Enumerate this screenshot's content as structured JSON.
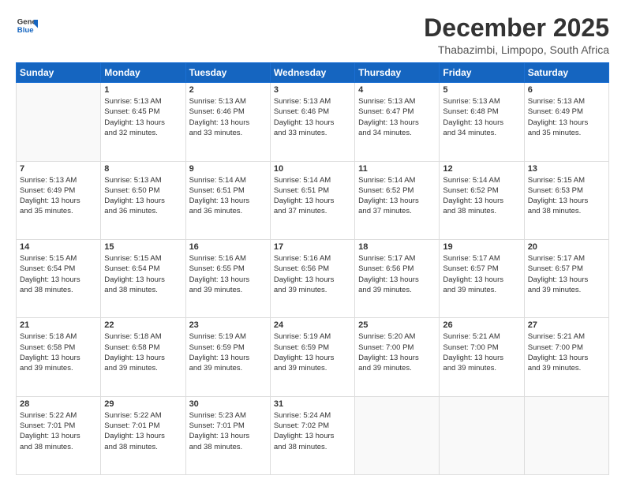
{
  "header": {
    "logo_line1": "General",
    "logo_line2": "Blue",
    "month": "December 2025",
    "location": "Thabazimbi, Limpopo, South Africa"
  },
  "weekdays": [
    "Sunday",
    "Monday",
    "Tuesday",
    "Wednesday",
    "Thursday",
    "Friday",
    "Saturday"
  ],
  "weeks": [
    [
      {
        "day": "",
        "text": ""
      },
      {
        "day": "1",
        "text": "Sunrise: 5:13 AM\nSunset: 6:45 PM\nDaylight: 13 hours\nand 32 minutes."
      },
      {
        "day": "2",
        "text": "Sunrise: 5:13 AM\nSunset: 6:46 PM\nDaylight: 13 hours\nand 33 minutes."
      },
      {
        "day": "3",
        "text": "Sunrise: 5:13 AM\nSunset: 6:46 PM\nDaylight: 13 hours\nand 33 minutes."
      },
      {
        "day": "4",
        "text": "Sunrise: 5:13 AM\nSunset: 6:47 PM\nDaylight: 13 hours\nand 34 minutes."
      },
      {
        "day": "5",
        "text": "Sunrise: 5:13 AM\nSunset: 6:48 PM\nDaylight: 13 hours\nand 34 minutes."
      },
      {
        "day": "6",
        "text": "Sunrise: 5:13 AM\nSunset: 6:49 PM\nDaylight: 13 hours\nand 35 minutes."
      }
    ],
    [
      {
        "day": "7",
        "text": "Sunrise: 5:13 AM\nSunset: 6:49 PM\nDaylight: 13 hours\nand 35 minutes."
      },
      {
        "day": "8",
        "text": "Sunrise: 5:13 AM\nSunset: 6:50 PM\nDaylight: 13 hours\nand 36 minutes."
      },
      {
        "day": "9",
        "text": "Sunrise: 5:14 AM\nSunset: 6:51 PM\nDaylight: 13 hours\nand 36 minutes."
      },
      {
        "day": "10",
        "text": "Sunrise: 5:14 AM\nSunset: 6:51 PM\nDaylight: 13 hours\nand 37 minutes."
      },
      {
        "day": "11",
        "text": "Sunrise: 5:14 AM\nSunset: 6:52 PM\nDaylight: 13 hours\nand 37 minutes."
      },
      {
        "day": "12",
        "text": "Sunrise: 5:14 AM\nSunset: 6:52 PM\nDaylight: 13 hours\nand 38 minutes."
      },
      {
        "day": "13",
        "text": "Sunrise: 5:15 AM\nSunset: 6:53 PM\nDaylight: 13 hours\nand 38 minutes."
      }
    ],
    [
      {
        "day": "14",
        "text": "Sunrise: 5:15 AM\nSunset: 6:54 PM\nDaylight: 13 hours\nand 38 minutes."
      },
      {
        "day": "15",
        "text": "Sunrise: 5:15 AM\nSunset: 6:54 PM\nDaylight: 13 hours\nand 38 minutes."
      },
      {
        "day": "16",
        "text": "Sunrise: 5:16 AM\nSunset: 6:55 PM\nDaylight: 13 hours\nand 39 minutes."
      },
      {
        "day": "17",
        "text": "Sunrise: 5:16 AM\nSunset: 6:56 PM\nDaylight: 13 hours\nand 39 minutes."
      },
      {
        "day": "18",
        "text": "Sunrise: 5:17 AM\nSunset: 6:56 PM\nDaylight: 13 hours\nand 39 minutes."
      },
      {
        "day": "19",
        "text": "Sunrise: 5:17 AM\nSunset: 6:57 PM\nDaylight: 13 hours\nand 39 minutes."
      },
      {
        "day": "20",
        "text": "Sunrise: 5:17 AM\nSunset: 6:57 PM\nDaylight: 13 hours\nand 39 minutes."
      }
    ],
    [
      {
        "day": "21",
        "text": "Sunrise: 5:18 AM\nSunset: 6:58 PM\nDaylight: 13 hours\nand 39 minutes."
      },
      {
        "day": "22",
        "text": "Sunrise: 5:18 AM\nSunset: 6:58 PM\nDaylight: 13 hours\nand 39 minutes."
      },
      {
        "day": "23",
        "text": "Sunrise: 5:19 AM\nSunset: 6:59 PM\nDaylight: 13 hours\nand 39 minutes."
      },
      {
        "day": "24",
        "text": "Sunrise: 5:19 AM\nSunset: 6:59 PM\nDaylight: 13 hours\nand 39 minutes."
      },
      {
        "day": "25",
        "text": "Sunrise: 5:20 AM\nSunset: 7:00 PM\nDaylight: 13 hours\nand 39 minutes."
      },
      {
        "day": "26",
        "text": "Sunrise: 5:21 AM\nSunset: 7:00 PM\nDaylight: 13 hours\nand 39 minutes."
      },
      {
        "day": "27",
        "text": "Sunrise: 5:21 AM\nSunset: 7:00 PM\nDaylight: 13 hours\nand 39 minutes."
      }
    ],
    [
      {
        "day": "28",
        "text": "Sunrise: 5:22 AM\nSunset: 7:01 PM\nDaylight: 13 hours\nand 38 minutes."
      },
      {
        "day": "29",
        "text": "Sunrise: 5:22 AM\nSunset: 7:01 PM\nDaylight: 13 hours\nand 38 minutes."
      },
      {
        "day": "30",
        "text": "Sunrise: 5:23 AM\nSunset: 7:01 PM\nDaylight: 13 hours\nand 38 minutes."
      },
      {
        "day": "31",
        "text": "Sunrise: 5:24 AM\nSunset: 7:02 PM\nDaylight: 13 hours\nand 38 minutes."
      },
      {
        "day": "",
        "text": ""
      },
      {
        "day": "",
        "text": ""
      },
      {
        "day": "",
        "text": ""
      }
    ]
  ]
}
